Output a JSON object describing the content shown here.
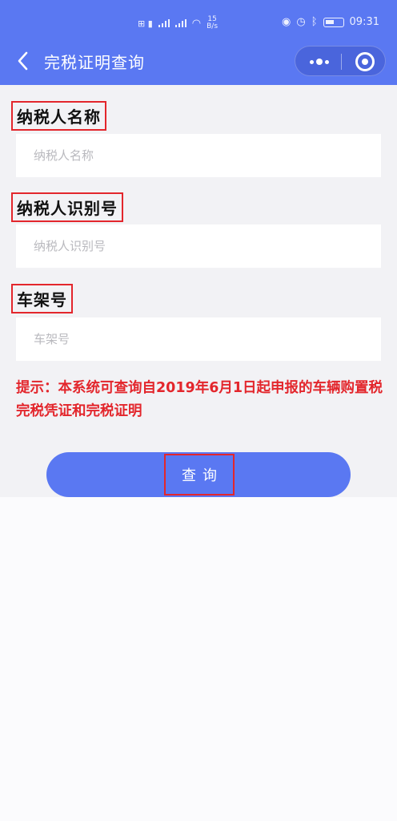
{
  "status_bar": {
    "network_left": "⊞ ▮",
    "speed": "15",
    "speed_unit": "B/s",
    "time": "09:31"
  },
  "nav": {
    "back_icon": "chevron-left-icon",
    "title": "完税证明查询",
    "more_icon": "more-dots-icon",
    "close_icon": "target-icon"
  },
  "form": {
    "taxpayer_name_label": "纳税人名称",
    "taxpayer_name_placeholder": "纳税人名称",
    "taxpayer_id_label": "纳税人识别号",
    "taxpayer_id_placeholder": "纳税人识别号",
    "vin_label": "车架号",
    "vin_placeholder": "车架号",
    "hint": "提示：本系统可查询自2019年6月1日起申报的车辆购置税完税凭证和完税证明",
    "query_label": "查询"
  },
  "colors": {
    "primary": "#5a78f2",
    "highlight": "#e3262c",
    "background": "#f2f2f5"
  }
}
